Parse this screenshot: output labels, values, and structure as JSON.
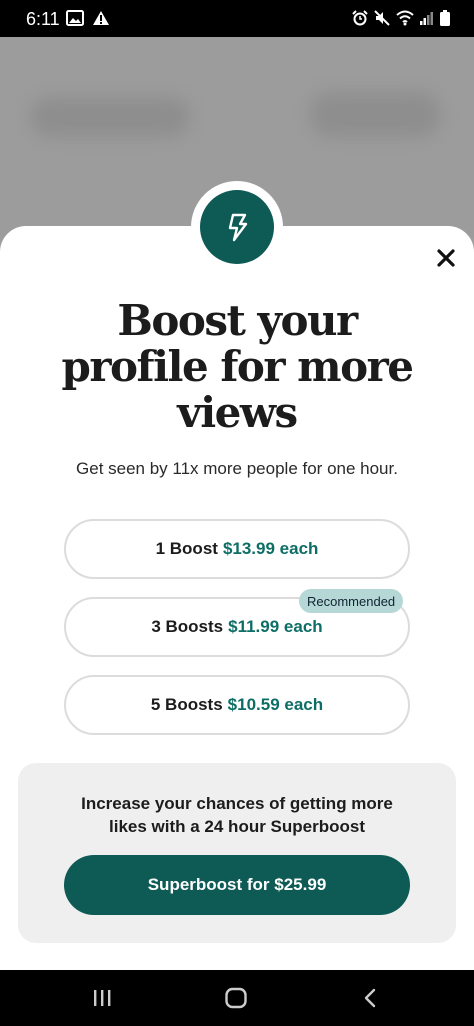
{
  "status_bar": {
    "time": "6:11",
    "left_icons": [
      "image-icon",
      "alert-icon"
    ],
    "right_icons": [
      "alarm-icon",
      "mute-icon",
      "wifi-icon",
      "signal-icon",
      "battery-icon"
    ]
  },
  "boost_sheet": {
    "badge_icon": "lightning-icon",
    "title_lines": [
      "Boost your",
      "profile for more",
      "views"
    ],
    "subtitle": "Get seen by 11x more people for one hour.",
    "options": [
      {
        "label": "1 Boost",
        "price": "$13.99 each"
      },
      {
        "label": "3 Boosts",
        "price": "$11.99 each",
        "tag": "Recommended"
      },
      {
        "label": "5 Boosts",
        "price": "$10.59 each"
      }
    ],
    "superboost": {
      "text_lines": [
        "Increase your chances of getting more",
        "likes with a 24 hour Superboost"
      ],
      "button_label": "Superboost for $25.99"
    }
  },
  "colors": {
    "accent": "#0e5a55",
    "price_text": "#0e6e66",
    "recommended_bg": "#b5d8d6",
    "panel_bg": "#efefef"
  },
  "nav_bar": {
    "icons": [
      "recent-apps-icon",
      "home-icon",
      "back-icon"
    ]
  }
}
